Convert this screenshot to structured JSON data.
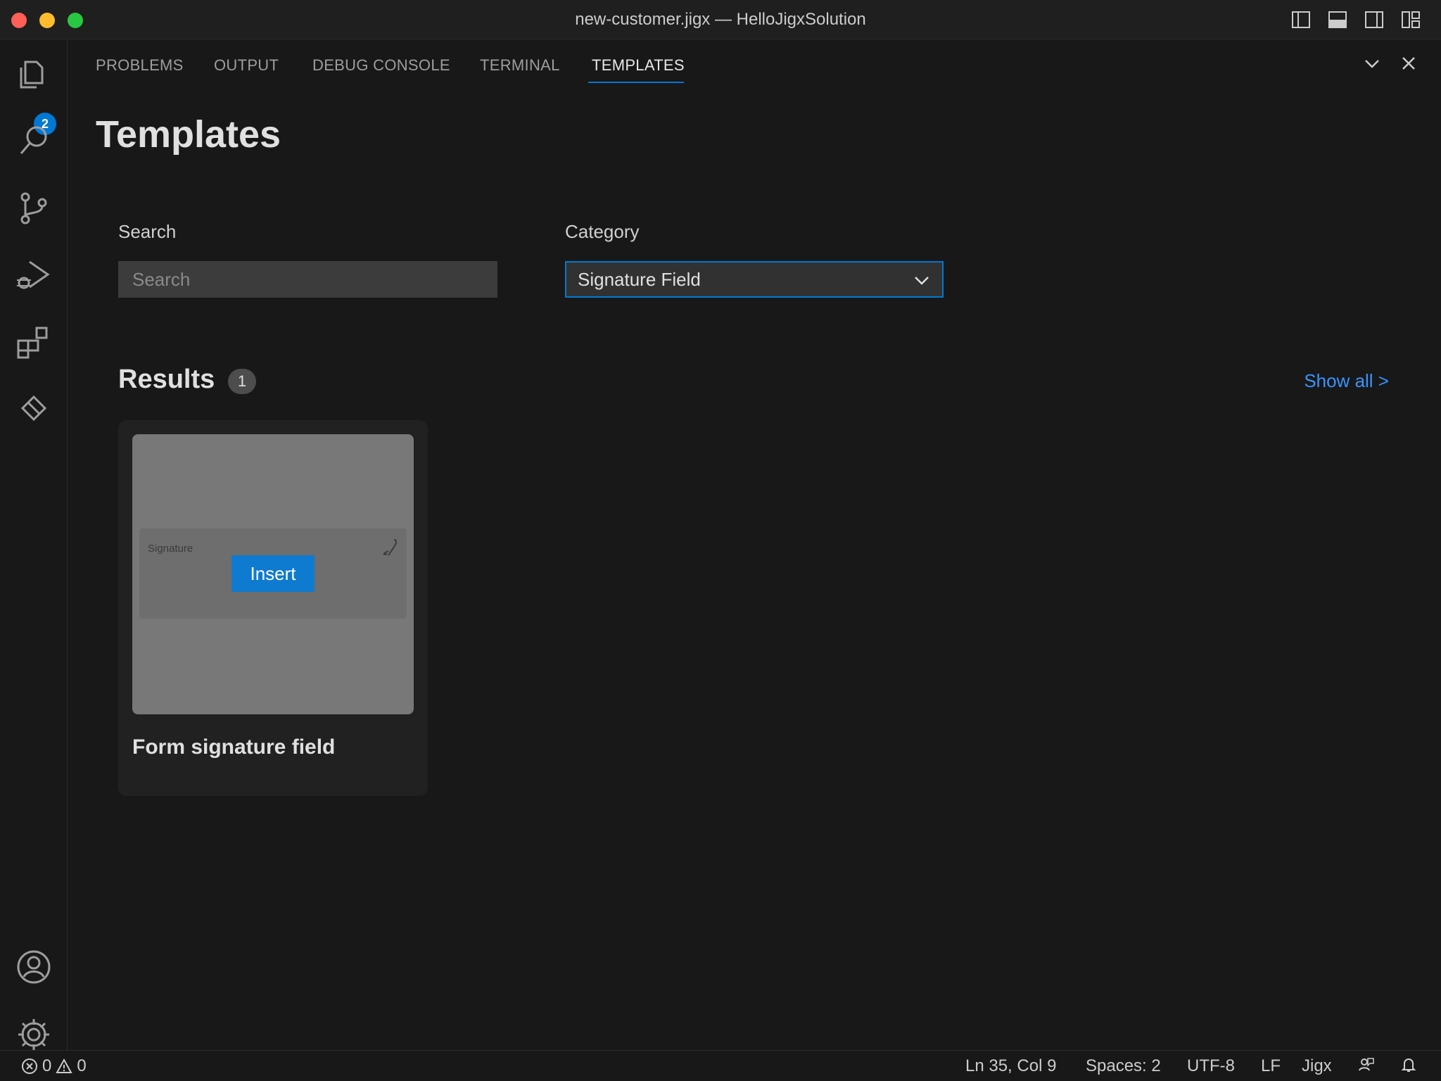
{
  "window": {
    "title": "new-customer.jigx — HelloJigxSolution"
  },
  "activity_bar": {
    "explorer_badge": "2"
  },
  "panel_tabs": [
    {
      "label": "PROBLEMS"
    },
    {
      "label": "OUTPUT"
    },
    {
      "label": "DEBUG CONSOLE"
    },
    {
      "label": "TERMINAL"
    },
    {
      "label": "TEMPLATES"
    }
  ],
  "templates": {
    "page_title": "Templates",
    "search_label": "Search",
    "search_placeholder": "Search",
    "search_value": "",
    "category_label": "Category",
    "category_value": "Signature Field",
    "results_title": "Results",
    "results_count": "1",
    "show_all": "Show all >",
    "cards": [
      {
        "title": "Form signature field",
        "preview_label": "Signature",
        "action": "Insert"
      }
    ]
  },
  "status_bar": {
    "errors": "0",
    "warnings": "0",
    "cursor": "Ln 35, Col 9",
    "spaces": "Spaces: 2",
    "encoding": "UTF-8",
    "eol": "LF",
    "language": "Jigx"
  },
  "colors": {
    "accent": "#0078d4",
    "link": "#3794ff",
    "background": "#181818"
  }
}
